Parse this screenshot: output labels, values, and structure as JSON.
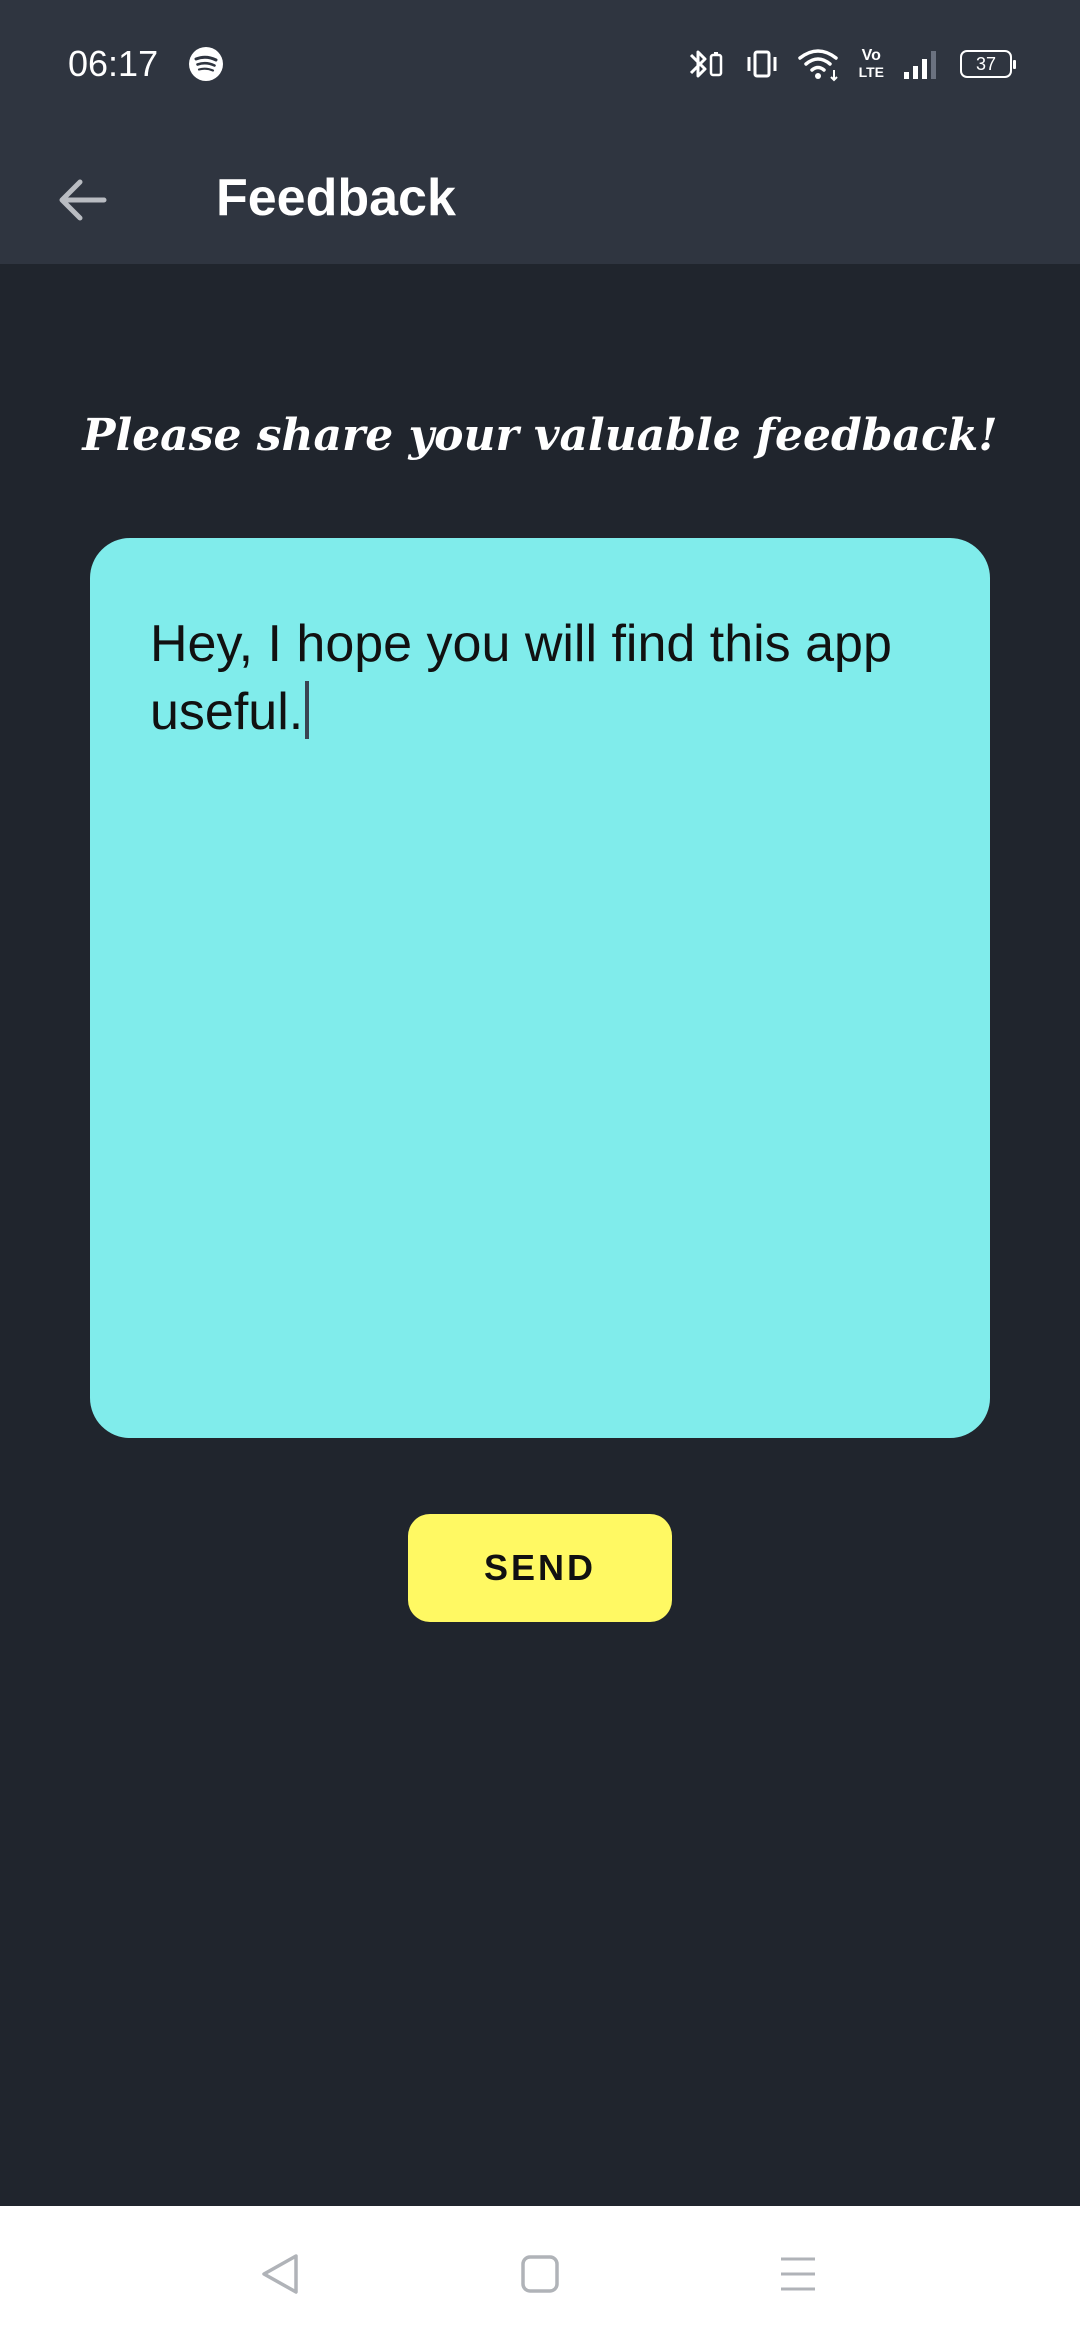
{
  "status_bar": {
    "time": "06:17",
    "battery_level": "37",
    "icons": [
      "spotify-icon",
      "bluetooth-icon",
      "vibrate-icon",
      "wifi-icon",
      "volte-icon",
      "signal-icon",
      "battery-icon"
    ],
    "volte_label_top": "Vo",
    "volte_label_bottom": "LTE"
  },
  "app_bar": {
    "title": "Feedback",
    "back_icon": "arrow-left-icon"
  },
  "main": {
    "prompt": "Please share your valuable feedback!",
    "feedback_value": "Hey, I hope you will find this app useful.",
    "send_label": "SEND"
  },
  "nav_bar": {
    "icons": [
      "nav-back-icon",
      "nav-home-icon",
      "nav-menu-icon"
    ]
  },
  "colors": {
    "background": "#20252d",
    "bar": "#2f3540",
    "feedback_box": "#80eceb",
    "send_button": "#fff963"
  }
}
